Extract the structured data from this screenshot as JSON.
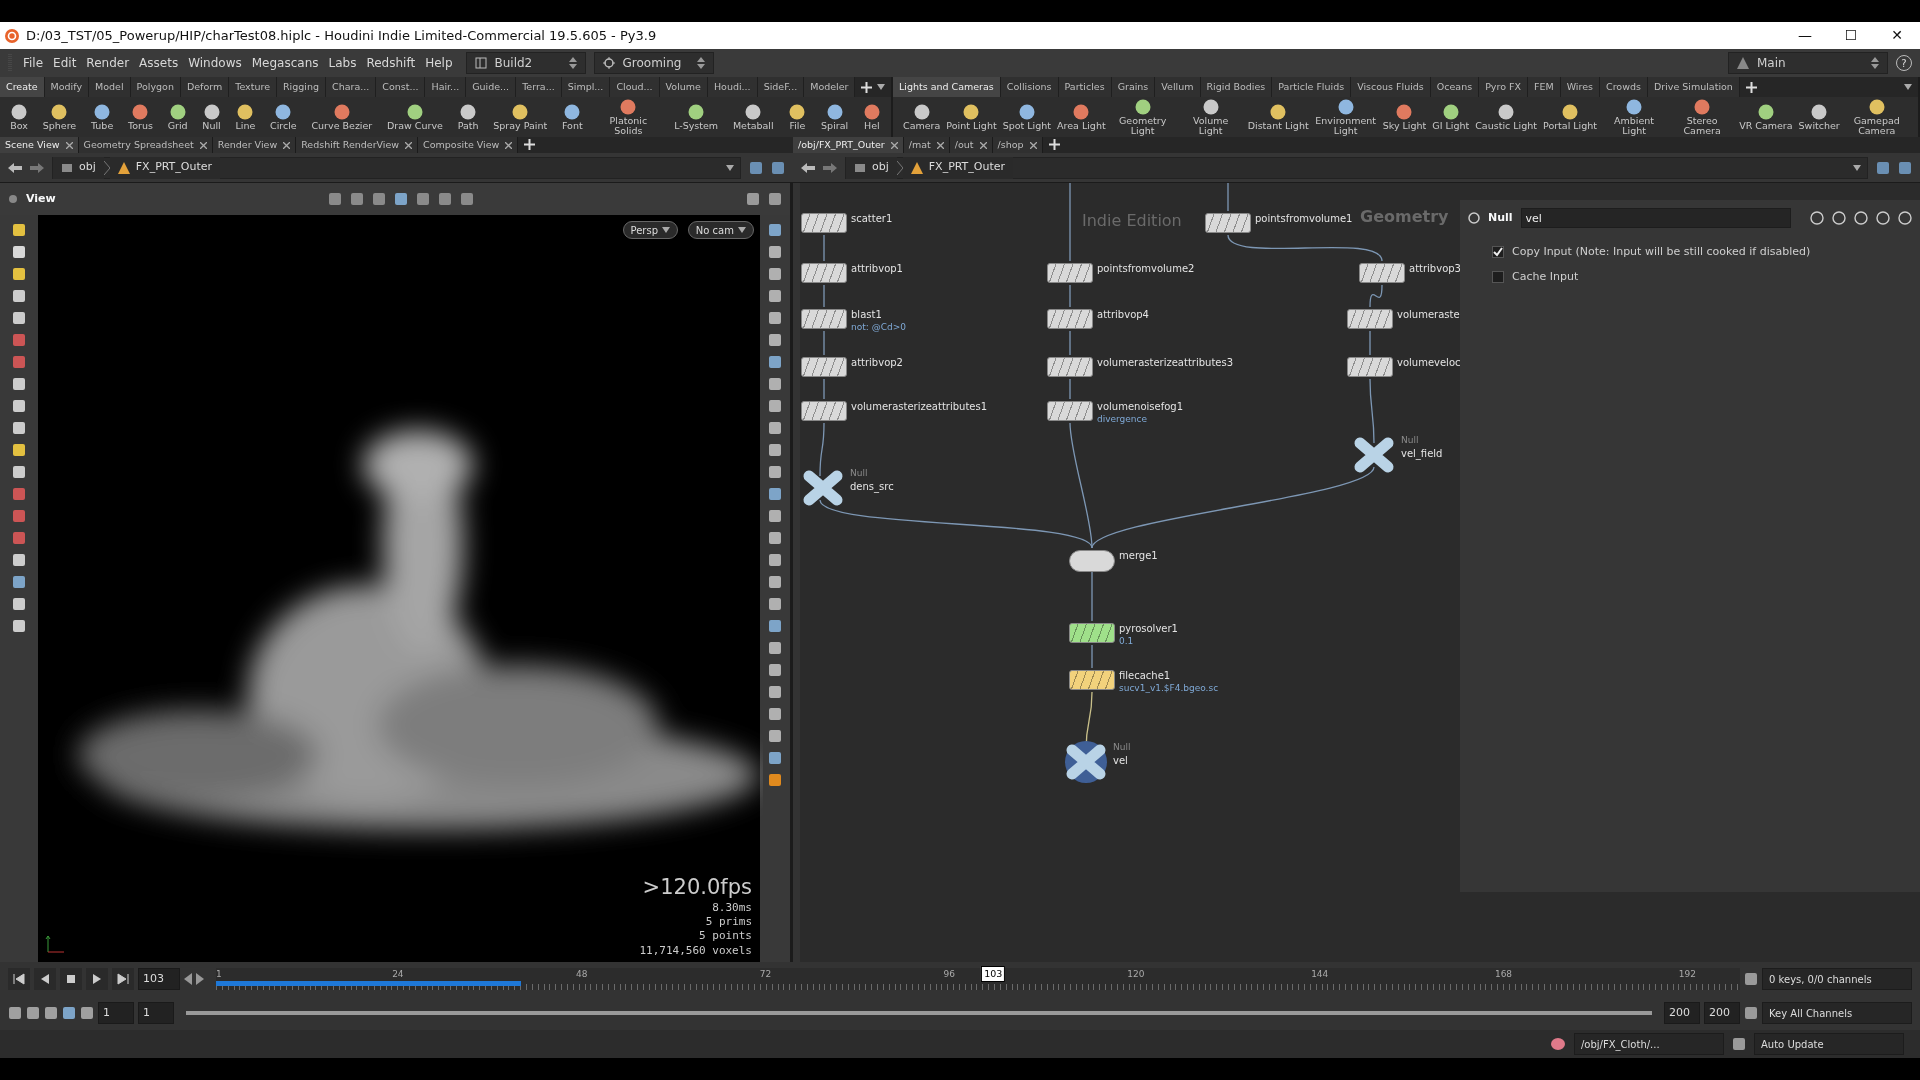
{
  "window": {
    "title": "D:/03_TST/05_Powerup/HIP/charTest08.hiplc - Houdini Indie Limited-Commercial 19.5.605 - Py3.9",
    "controls": [
      "—",
      "☐",
      "✕"
    ]
  },
  "menu": [
    "File",
    "Edit",
    "Render",
    "Assets",
    "Windows",
    "Megascans",
    "Labs",
    "Redshift",
    "Help"
  ],
  "desktops": [
    {
      "label": "Build2"
    },
    {
      "label": "Grooming"
    }
  ],
  "desktop_right": {
    "label": "Main",
    "help": "?"
  },
  "shelves": [
    {
      "tabs": [
        {
          "label": "Create",
          "selected": true
        },
        {
          "label": "Modify",
          "selected": false
        },
        {
          "label": "Model",
          "selected": false
        },
        {
          "label": "Polygon",
          "selected": false
        },
        {
          "label": "Deform",
          "selected": false
        },
        {
          "label": "Texture",
          "selected": false
        },
        {
          "label": "Rigging",
          "selected": false
        },
        {
          "label": "Chara...",
          "selected": false
        },
        {
          "label": "Const...",
          "selected": false
        },
        {
          "label": "Hair...",
          "selected": false
        },
        {
          "label": "Guide...",
          "selected": false
        },
        {
          "label": "Terra...",
          "selected": false
        },
        {
          "label": "Simpl...",
          "selected": false
        },
        {
          "label": "Cloud...",
          "selected": false
        },
        {
          "label": "Volume",
          "selected": false
        },
        {
          "label": "Houdi...",
          "selected": false
        },
        {
          "label": "SideF...",
          "selected": false
        },
        {
          "label": "Modeler",
          "selected": false
        }
      ],
      "tools": [
        "Box",
        "Sphere",
        "Tube",
        "Torus",
        "Grid",
        "Null",
        "Line",
        "Circle",
        "Curve Bezier",
        "Draw Curve",
        "Path",
        "Spray Paint",
        "Font",
        "Platonic Solids",
        "L-System",
        "Metaball",
        "File",
        "Spiral",
        "Hel"
      ]
    },
    {
      "tabs": [
        {
          "label": "Lights and Cameras",
          "selected": true
        },
        {
          "label": "Collisions",
          "selected": false
        },
        {
          "label": "Particles",
          "selected": false
        },
        {
          "label": "Grains",
          "selected": false
        },
        {
          "label": "Vellum",
          "selected": false
        },
        {
          "label": "Rigid Bodies",
          "selected": false
        },
        {
          "label": "Particle Fluids",
          "selected": false
        },
        {
          "label": "Viscous Fluids",
          "selected": false
        },
        {
          "label": "Oceans",
          "selected": false
        },
        {
          "label": "Pyro FX",
          "selected": false
        },
        {
          "label": "FEM",
          "selected": false
        },
        {
          "label": "Wires",
          "selected": false
        },
        {
          "label": "Crowds",
          "selected": false
        },
        {
          "label": "Drive Simulation",
          "selected": false
        }
      ],
      "tools": [
        "Camera",
        "Point Light",
        "Spot Light",
        "Area Light",
        "Geometry Light",
        "Volume Light",
        "Distant Light",
        "Environment Light",
        "Sky Light",
        "GI Light",
        "Caustic Light",
        "Portal Light",
        "Ambient Light",
        "Stereo Camera",
        "VR Camera",
        "Switcher",
        "Gamepad Camera"
      ]
    }
  ],
  "panes": [
    {
      "tabs": [
        {
          "label": "Scene View",
          "selected": true
        },
        {
          "label": "Geometry Spreadsheet",
          "selected": false
        },
        {
          "label": "Render View",
          "selected": false
        },
        {
          "label": "Redshift RenderView",
          "selected": false
        },
        {
          "label": "Composite View",
          "selected": false
        }
      ],
      "path": [
        "obj",
        "FX_PRT_Outer"
      ]
    },
    {
      "tabs": [
        {
          "label": "/obj/FX_PRT_Outer",
          "selected": true
        },
        {
          "label": "/mat",
          "selected": false
        },
        {
          "label": "/out",
          "selected": false
        },
        {
          "label": "/shop",
          "selected": false
        }
      ],
      "path": [
        "obj",
        "FX_PRT_Outer"
      ]
    }
  ],
  "viewport": {
    "title": "View",
    "camera_buttons": [
      "Persp",
      "No cam"
    ],
    "fps": ">120.0fps",
    "ms": "8.30ms",
    "stats": [
      "5 prims",
      "5 points",
      "11,714,560 voxels"
    ]
  },
  "network": {
    "overlay_texts": [
      "Indie Edition",
      "Geometry"
    ],
    "nodes": [
      {
        "name": "scatter1",
        "kind": "box",
        "color": "#d9d9d9",
        "display": false
      },
      {
        "name": "pointsfromvolume1",
        "kind": "box",
        "color": "#d9d9d9",
        "display": false
      },
      {
        "name": "attribvop1",
        "kind": "box",
        "color": "#d9d9d9",
        "display": false
      },
      {
        "name": "pointsfromvolume2",
        "kind": "box",
        "color": "#d9d9d9",
        "display": false
      },
      {
        "name": "attribvop3",
        "kind": "box",
        "color": "#d9d9d9",
        "display": false
      },
      {
        "name": "blast1",
        "kind": "box",
        "color": "#d9d9d9",
        "display": false,
        "comment": "not: @Cd>0"
      },
      {
        "name": "attribvop4",
        "kind": "box",
        "color": "#d9d9d9",
        "display": false
      },
      {
        "name": "volumeraste",
        "kind": "box",
        "color": "#d9d9d9",
        "display": false
      },
      {
        "name": "attribvop2",
        "kind": "box",
        "color": "#d9d9d9",
        "display": false
      },
      {
        "name": "volumerasterizeattributes3",
        "kind": "box",
        "color": "#d9d9d9",
        "display": false
      },
      {
        "name": "volumeveloc",
        "kind": "box",
        "color": "#d9d9d9",
        "display": false
      },
      {
        "name": "volumerasterizeattributes1",
        "kind": "box",
        "color": "#d9d9d9",
        "display": false
      },
      {
        "name": "volumenoisefog1",
        "kind": "box",
        "color": "#d9d9d9",
        "display": false,
        "comment": "divergence"
      },
      {
        "name": "vel_field",
        "kind": "null",
        "type_label": "Null",
        "color": "#b9d3e6",
        "display": false
      },
      {
        "name": "dens_src",
        "kind": "null",
        "type_label": "Null",
        "color": "#b9d3e6",
        "display": false
      },
      {
        "name": "merge1",
        "kind": "merge",
        "color": "#d9d9d9",
        "display": false
      },
      {
        "name": "pyrosolver1",
        "kind": "box",
        "color": "#9fe08a",
        "display": false,
        "comment": "0.1"
      },
      {
        "name": "filecache1",
        "kind": "box",
        "color": "#f2d27c",
        "display": false,
        "comment": "sucv1_v1.$F4.bgeo.sc"
      },
      {
        "name": "vel",
        "kind": "null",
        "type_label": "Null",
        "color": "#b9d3e6",
        "display": true
      }
    ]
  },
  "parameters": {
    "type": "Null",
    "name": "vel",
    "rows": [
      {
        "label": "Copy Input (Note: Input will be still cooked if disabled)",
        "checked": true
      },
      {
        "label": "Cache Input",
        "checked": false
      }
    ]
  },
  "timeline": {
    "frame": "103",
    "cache": {
      "level": 0.2
    },
    "playhead": {
      "label": "103",
      "level": 0.51
    },
    "ticks": [
      "1",
      "24",
      "48",
      "72",
      "96",
      "120",
      "144",
      "168",
      "192"
    ],
    "keys": "0 keys, 0/0 channels",
    "range": {
      "level": 1
    },
    "start": "1",
    "start_sub": "1",
    "end": "200",
    "end_sub": "200",
    "key_all": "Key All Channels"
  },
  "status_bar": {
    "path": "/obj/FX_Cloth/...",
    "update": "Auto Update"
  }
}
